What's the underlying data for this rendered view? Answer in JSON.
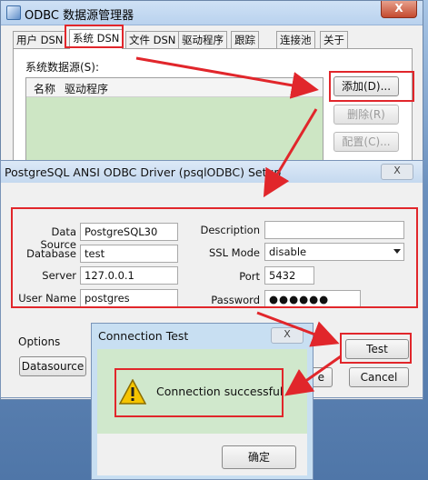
{
  "odbc": {
    "title": "ODBC 数据源管理器",
    "close_label": "X",
    "tabs": [
      "用户 DSN",
      "系统 DSN",
      "文件 DSN",
      "驱动程序",
      "跟踪",
      "连接池",
      "关于"
    ],
    "system_ds_label": "系统数据源(S):",
    "columns": [
      "名称",
      "驱动程序"
    ],
    "buttons": {
      "add": "添加(D)...",
      "remove": "删除(R)",
      "configure": "配置(C)..."
    }
  },
  "pg": {
    "title": "PostgreSQL ANSI ODBC Driver (psqlODBC) Setup",
    "close_label": "X",
    "labels": {
      "data_source": "Data Source",
      "database": "Database",
      "server": "Server",
      "user_name": "User Name",
      "description": "Description",
      "ssl_mode": "SSL Mode",
      "port": "Port",
      "password": "Password"
    },
    "values": {
      "data_source": "PostgreSQL30",
      "database": "test",
      "server": "127.0.0.1",
      "user_name": "postgres",
      "description": "",
      "ssl_mode": "disable",
      "port": "5432",
      "password": "●●●●●●"
    },
    "options_label": "Options",
    "buttons": {
      "datasource": "Datasource",
      "test": "Test",
      "save": "e",
      "cancel": "Cancel"
    }
  },
  "connection_test": {
    "title": "Connection Test",
    "close_label": "X",
    "message": "Connection successful",
    "ok_label": "确定"
  },
  "colors": {
    "annotation": "#e1262b",
    "success_bg": "#d0e8cc"
  }
}
